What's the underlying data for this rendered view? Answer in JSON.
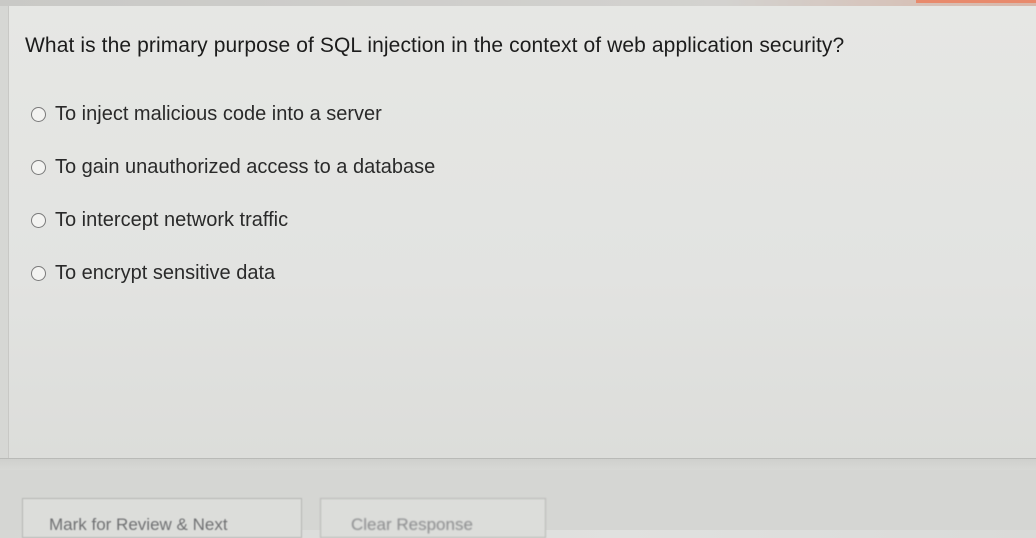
{
  "question": {
    "text": "What is the primary purpose of SQL injection in the context of web application security?"
  },
  "options": [
    {
      "label": "To inject malicious code into a server",
      "selected": false
    },
    {
      "label": "To gain unauthorized access to a database",
      "selected": false
    },
    {
      "label": "To intercept network traffic",
      "selected": false
    },
    {
      "label": "To encrypt sensitive data",
      "selected": false
    }
  ],
  "footer": {
    "mark_review_label": "Mark for Review & Next",
    "clear_response_label": "Clear Response"
  },
  "colors": {
    "background": "#e2e3e1",
    "text": "#1c1c1c",
    "radio_border": "#7a7a7a",
    "accent": "#e88a6c"
  }
}
